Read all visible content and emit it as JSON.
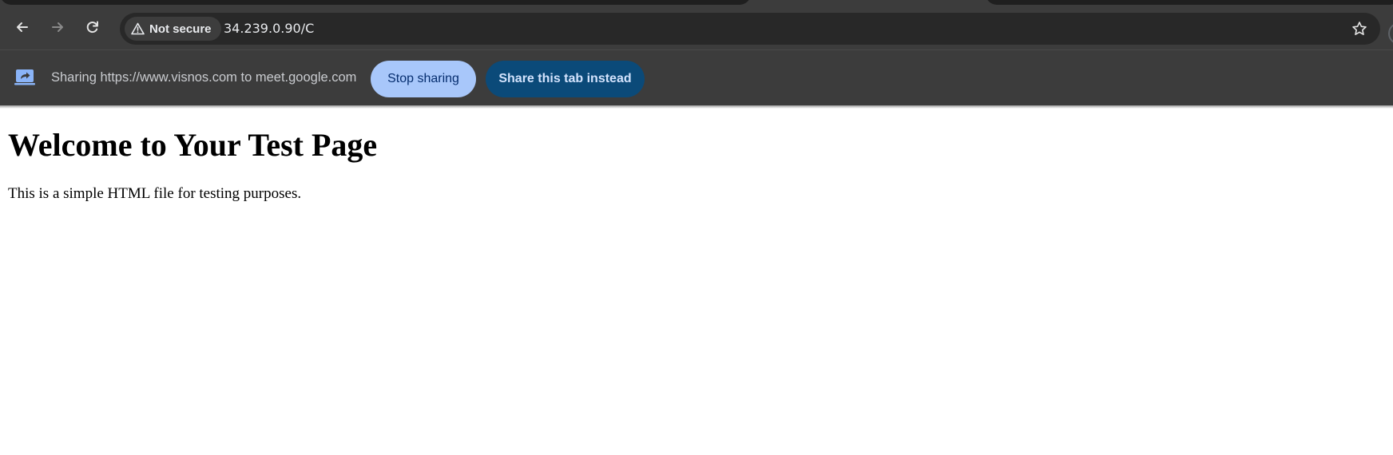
{
  "browser": {
    "toolbar": {
      "back_icon": "arrow-left-icon",
      "forward_icon": "arrow-right-icon",
      "reload_icon": "reload-icon",
      "security_label": "Not secure",
      "security_icon": "warning-triangle-icon",
      "url": "34.239.0.90/C",
      "bookmark_icon": "star-outline-icon"
    },
    "infobar": {
      "icon": "screen-share-icon",
      "message": "Sharing https://www.visnos.com to meet.google.com",
      "stop_label": "Stop sharing",
      "share_tab_label": "Share this tab instead"
    }
  },
  "page": {
    "heading": "Welcome to Your Test Page",
    "paragraph": "This is a simple HTML file for testing purposes."
  },
  "colors": {
    "chrome_bg": "#3c3c3c",
    "omnibox_bg": "#282828",
    "stop_button_bg": "#a8c7fa",
    "share_tab_button_bg": "#0b4a79"
  }
}
